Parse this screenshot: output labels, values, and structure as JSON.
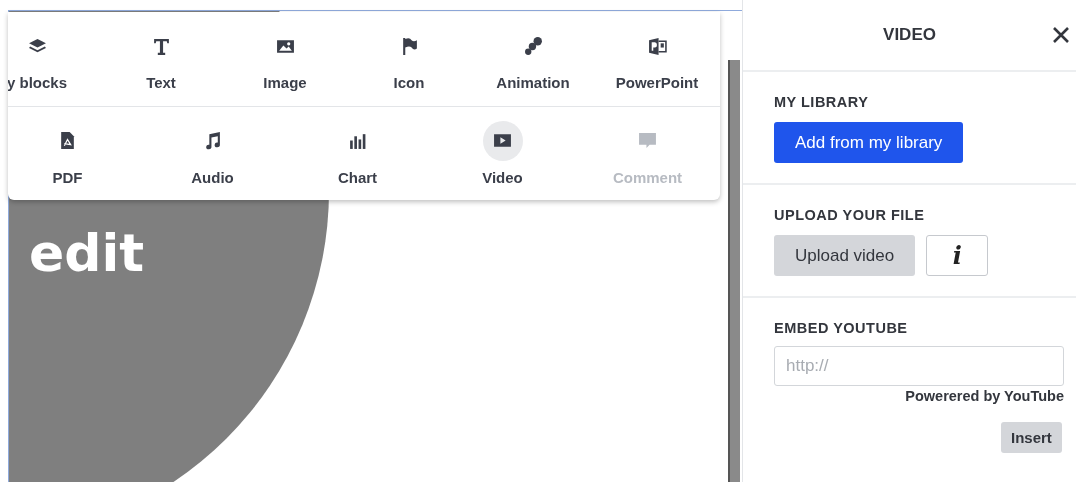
{
  "canvas": {
    "slide_text": "edit"
  },
  "insert_menu": {
    "rows": [
      {
        "items": [
          {
            "kind": "blocks",
            "label": "y blocks",
            "selected": false,
            "disabled": false
          },
          {
            "kind": "text",
            "label": "Text",
            "selected": false,
            "disabled": false
          },
          {
            "kind": "image",
            "label": "Image",
            "selected": false,
            "disabled": false
          },
          {
            "kind": "icon",
            "label": "Icon",
            "selected": false,
            "disabled": false
          },
          {
            "kind": "animation",
            "label": "Animation",
            "selected": false,
            "disabled": false
          },
          {
            "kind": "powerpoint",
            "label": "PowerPoint",
            "selected": false,
            "disabled": false
          }
        ]
      },
      {
        "items": [
          {
            "kind": "pdf",
            "label": "PDF",
            "selected": false,
            "disabled": false
          },
          {
            "kind": "audio",
            "label": "Audio",
            "selected": false,
            "disabled": false
          },
          {
            "kind": "chart",
            "label": "Chart",
            "selected": false,
            "disabled": false
          },
          {
            "kind": "video",
            "label": "Video",
            "selected": true,
            "disabled": false
          },
          {
            "kind": "comment",
            "label": "Comment",
            "selected": false,
            "disabled": true
          }
        ]
      }
    ]
  },
  "panel": {
    "title": "VIDEO",
    "library": {
      "heading": "MY LIBRARY",
      "button": "Add from my library"
    },
    "upload": {
      "heading": "UPLOAD YOUR FILE",
      "button": "Upload video",
      "info": "i"
    },
    "embed": {
      "heading": "EMBED YOUTUBE",
      "placeholder": "http://",
      "credit": "Powerered by YouTube",
      "button": "Insert"
    }
  }
}
